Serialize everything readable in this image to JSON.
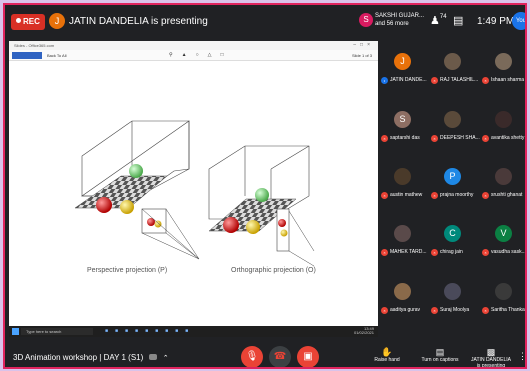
{
  "topbar": {
    "rec_label": "REC",
    "presenter_initial": "J",
    "presenting_text": "JATIN DANDELIA is presenting",
    "pinned_initial": "S",
    "pinned_line1": "SAKSHI GUJAR...",
    "pinned_line2": "and 56 more",
    "people_count": "74",
    "time": "1:49 PM",
    "self_label": "You"
  },
  "shared_window": {
    "title": "Slides - Office365.com",
    "toolbar_left": "Back To All",
    "toolbar_right": "Slide 1 of 3",
    "perspective_label": "Perspective projection (P)",
    "orthographic_label": "Orthographic projection (O)",
    "search_placeholder": "Type here to search",
    "taskbar_time": "13:49",
    "taskbar_date": "01/02/2021"
  },
  "participants": [
    {
      "name": "JATIN DANDE...",
      "initial": "J",
      "color": "#e8710a",
      "mic": "on"
    },
    {
      "name": "RAJ TALASHIL...",
      "initial": "",
      "color": "#6b5a4a",
      "mic": "off"
    },
    {
      "name": "Ishaan sharma",
      "initial": "",
      "color": "#7a6a5a",
      "mic": "off"
    },
    {
      "name": "saptarshi das",
      "initial": "S",
      "color": "#8d6e63",
      "mic": "off"
    },
    {
      "name": "DEEPESH SHA...",
      "initial": "",
      "color": "#5a4a3a",
      "mic": "off"
    },
    {
      "name": "avantika shetty",
      "initial": "",
      "color": "#3a2a2a",
      "mic": "off"
    },
    {
      "name": "austin mathew",
      "initial": "",
      "color": "#4a3a2a",
      "mic": "off"
    },
    {
      "name": "prajna moorthy",
      "initial": "P",
      "color": "#1e88e5",
      "mic": "off"
    },
    {
      "name": "srushti ghanat",
      "initial": "",
      "color": "#4a3a3a",
      "mic": "off"
    },
    {
      "name": "MAHEK TARD...",
      "initial": "",
      "color": "#5a4a4a",
      "mic": "off"
    },
    {
      "name": "chirag jain",
      "initial": "C",
      "color": "#00897b",
      "mic": "off"
    },
    {
      "name": "vasudha sask...",
      "initial": "V",
      "color": "#0b8043",
      "mic": "off"
    },
    {
      "name": "aaditya gurav",
      "initial": "",
      "color": "#8a6a4a",
      "mic": "off"
    },
    {
      "name": "Suraj Moolya",
      "initial": "",
      "color": "#4a4a5a",
      "mic": "off"
    },
    {
      "name": "Saritha Thanka...",
      "initial": "",
      "color": "#3a3a3a",
      "mic": "off"
    }
  ],
  "bottombar": {
    "meeting_title": "3D Animation workshop | DAY 1 (S1)",
    "raise_hand": "Raise hand",
    "captions": "Turn on captions",
    "presenter_line1": "JATIN DANDELIA",
    "presenter_line2": "is presenting"
  },
  "colors": {
    "accent_red": "#ea4335",
    "recording": "#d93025",
    "frame": "#e0245e"
  }
}
